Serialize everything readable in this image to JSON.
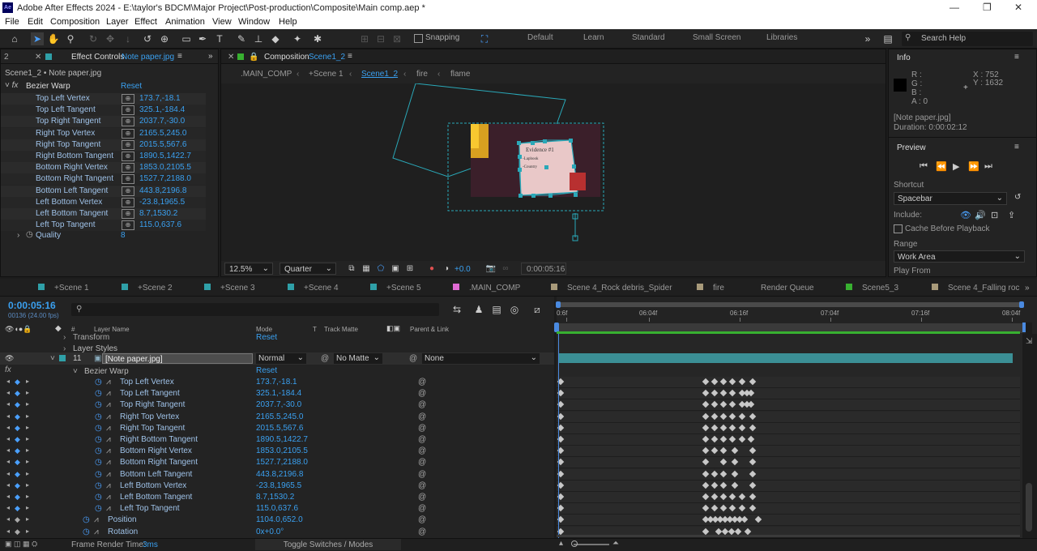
{
  "title": "Adobe After Effects 2024 - E:\\taylor's BDCM\\Major Project\\Post-production\\Composite\\Main comp.aep *",
  "logo": "Ae",
  "menu": [
    "File",
    "Edit",
    "Composition",
    "Layer",
    "Effect",
    "Animation",
    "View",
    "Window",
    "Help"
  ],
  "toolbar": {
    "snapping": "Snapping",
    "workspaces": [
      "Default",
      "Learn",
      "Standard",
      "Small Screen",
      "Libraries"
    ],
    "search": "Search Help"
  },
  "effect_controls": {
    "tab_num": "2",
    "tab_label": "Effect Controls",
    "tab_file": "Note paper.jpg",
    "breadcrumb": "Scene1_2 • Note paper.jpg",
    "effect": "Bezier Warp",
    "reset": "Reset",
    "params": [
      {
        "name": "Top Left Vertex",
        "value": "173.7,-18.1"
      },
      {
        "name": "Top Left Tangent",
        "value": "325.1,-184.4"
      },
      {
        "name": "Top Right Tangent",
        "value": "2037.7,-30.0"
      },
      {
        "name": "Right Top Vertex",
        "value": "2165.5,245.0"
      },
      {
        "name": "Right Top Tangent",
        "value": "2015.5,567.6"
      },
      {
        "name": "Right Bottom Tangent",
        "value": "1890.5,1422.7"
      },
      {
        "name": "Bottom Right Vertex",
        "value": "1853.0,2105.5"
      },
      {
        "name": "Bottom Right Tangent",
        "value": "1527.7,2188.0"
      },
      {
        "name": "Bottom Left Tangent",
        "value": "443.8,2196.8"
      },
      {
        "name": "Left Bottom Vertex",
        "value": "-23.8,1965.5"
      },
      {
        "name": "Left Bottom Tangent",
        "value": "8.7,1530.2"
      },
      {
        "name": "Left Top Tangent",
        "value": "115.0,637.6"
      }
    ],
    "quality_label": "Quality",
    "quality_value": "8"
  },
  "composition": {
    "tab_label": "Composition",
    "tab_name": "Scene1_2",
    "crumbs": [
      ".MAIN_COMP",
      "+Scene 1",
      "Scene1_2",
      "fire",
      "flame"
    ],
    "zoom": "12.5%",
    "resolution": "Quarter",
    "exposure": "+0.0",
    "timecode": "0:00:05:16",
    "card_title": "Evidence #1",
    "card_lines": [
      "-Lapbook",
      "-Country"
    ]
  },
  "info": {
    "title": "Info",
    "r": "R :",
    "g": "G :",
    "b": "B :",
    "a": "A : 0",
    "x": "X : 752",
    "y": "Y : 1632",
    "layer": "[Note paper.jpg]",
    "duration": "Duration: 0:00:02:12"
  },
  "preview": {
    "title": "Preview",
    "shortcut_label": "Shortcut",
    "shortcut": "Spacebar",
    "include": "Include:",
    "cache": "Cache Before Playback",
    "range_label": "Range",
    "range": "Work Area",
    "play_from": "Play From"
  },
  "timeline": {
    "tabs": [
      "+Scene 1",
      "+Scene 2",
      "+Scene 3",
      "+Scene 4",
      "+Scene 5",
      ".MAIN_COMP",
      "Scene 4_Rock debris_Spider",
      "fire",
      "Render Queue",
      "Scene5_3",
      "Scene 4_Falling roc"
    ],
    "tab_colors": [
      "#2fa0a8",
      "#2fa0a8",
      "#2fa0a8",
      "#2fa0a8",
      "#2fa0a8",
      "#e06ad3",
      "#a89a7a",
      "#a89a7a",
      "",
      "#38b030",
      "#a89a7a"
    ],
    "timecode": "0:00:05:16",
    "fps": "00136 (24.00 fps)",
    "headers": {
      "layer_name": "Layer Name",
      "mode": "Mode",
      "t": "T",
      "track_matte": "Track Matte",
      "parent": "Parent & Link"
    },
    "ruler": [
      "0:6f",
      "06:04f",
      "06:16f",
      "07:04f",
      "07:16f",
      "08:04f"
    ],
    "transform": "Transform",
    "transform_reset": "Reset",
    "layer_styles": "Layer Styles",
    "layer": {
      "num": "11",
      "name": "[Note paper.jpg]",
      "mode": "Normal",
      "matte": "No Matte",
      "parent": "None"
    },
    "effect": "Bezier Warp",
    "effect_reset": "Reset",
    "props": [
      {
        "name": "Top Left Vertex",
        "value": "173.7,-18.1"
      },
      {
        "name": "Top Left Tangent",
        "value": "325.1,-184.4"
      },
      {
        "name": "Top Right Tangent",
        "value": "2037.7,-30.0"
      },
      {
        "name": "Right Top Vertex",
        "value": "2165.5,245.0"
      },
      {
        "name": "Right Top Tangent",
        "value": "2015.5,567.6"
      },
      {
        "name": "Right Bottom Tangent",
        "value": "1890.5,1422.7"
      },
      {
        "name": "Bottom Right Vertex",
        "value": "1853.0,2105.5"
      },
      {
        "name": "Bottom Right Tangent",
        "value": "1527.7,2188.0"
      },
      {
        "name": "Bottom Left Tangent",
        "value": "443.8,2196.8"
      },
      {
        "name": "Left Bottom Vertex",
        "value": "-23.8,1965.5"
      },
      {
        "name": "Left Bottom Tangent",
        "value": "8.7,1530.2"
      },
      {
        "name": "Left Top Tangent",
        "value": "115.0,637.6"
      },
      {
        "name": "Position",
        "value": "1104.0,652.0"
      },
      {
        "name": "Rotation",
        "value": "0x+0.0°"
      }
    ],
    "render_time_label": "Frame Render Time:",
    "render_time": "3ms",
    "toggle": "Toggle Switches / Modes"
  }
}
